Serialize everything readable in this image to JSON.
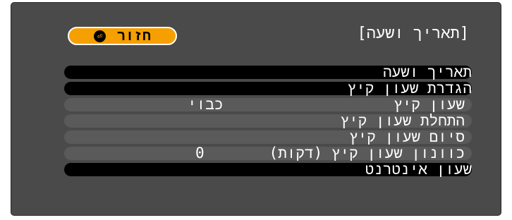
{
  "header": {
    "title": "[תאריך ושעה]",
    "back_button": {
      "label": "חזור",
      "icon": "back-arrow-icon",
      "icon_glyph": "⏎"
    }
  },
  "menu": {
    "items": [
      {
        "label": "תאריך ושעה",
        "value": ""
      },
      {
        "label": "הגדרת שעון קיץ",
        "value": ""
      },
      {
        "label": "שעון קיץ",
        "value": "כבוי"
      },
      {
        "label": "התחלת שעון קיץ",
        "value": ""
      },
      {
        "label": "סיום שעון קיץ",
        "value": ""
      },
      {
        "label": "כוונון שעון קיץ (דקות)",
        "value": "0"
      },
      {
        "label": "שעון אינטרנט",
        "value": ""
      }
    ]
  },
  "colors": {
    "panel_background": "#4a4a4a",
    "top_row_background": "#000000",
    "sub_row_background": "#5a5a5a",
    "accent": "#f5a000",
    "text": "#ffffff"
  }
}
